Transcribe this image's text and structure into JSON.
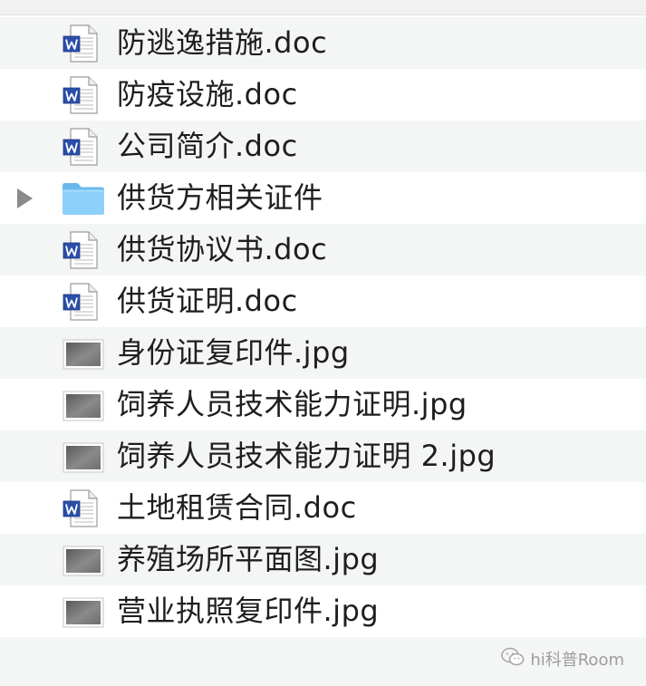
{
  "files": [
    {
      "name": "防逃逸措施.doc",
      "icon": "word-doc-icon",
      "expandable": false
    },
    {
      "name": "防疫设施.doc",
      "icon": "word-doc-icon",
      "expandable": false
    },
    {
      "name": "公司简介.doc",
      "icon": "word-doc-icon",
      "expandable": false
    },
    {
      "name": "供货方相关证件",
      "icon": "folder-icon",
      "expandable": true
    },
    {
      "name": "供货协议书.doc",
      "icon": "word-doc-icon",
      "expandable": false
    },
    {
      "name": "供货证明.doc",
      "icon": "word-doc-icon",
      "expandable": false
    },
    {
      "name": "身份证复印件.jpg",
      "icon": "image-thumbnail-icon",
      "expandable": false
    },
    {
      "name": "饲养人员技术能力证明.jpg",
      "icon": "image-thumbnail-icon",
      "expandable": false
    },
    {
      "name": "饲养人员技术能力证明 2.jpg",
      "icon": "image-thumbnail-icon",
      "expandable": false
    },
    {
      "name": "土地租赁合同.doc",
      "icon": "word-doc-icon",
      "expandable": false
    },
    {
      "name": "养殖场所平面图.jpg",
      "icon": "image-thumbnail-icon",
      "expandable": false
    },
    {
      "name": "营业执照复印件.jpg",
      "icon": "image-thumbnail-icon",
      "expandable": false
    }
  ],
  "watermark": {
    "text": "hi科普Room",
    "icon": "wechat-icon"
  },
  "colors": {
    "row_alt": "#f4f5f5",
    "text": "#1e1e1e",
    "folder": "#6ec0f2",
    "word_blue": "#2b4fa8",
    "disclosure": "#8a8a8a"
  }
}
